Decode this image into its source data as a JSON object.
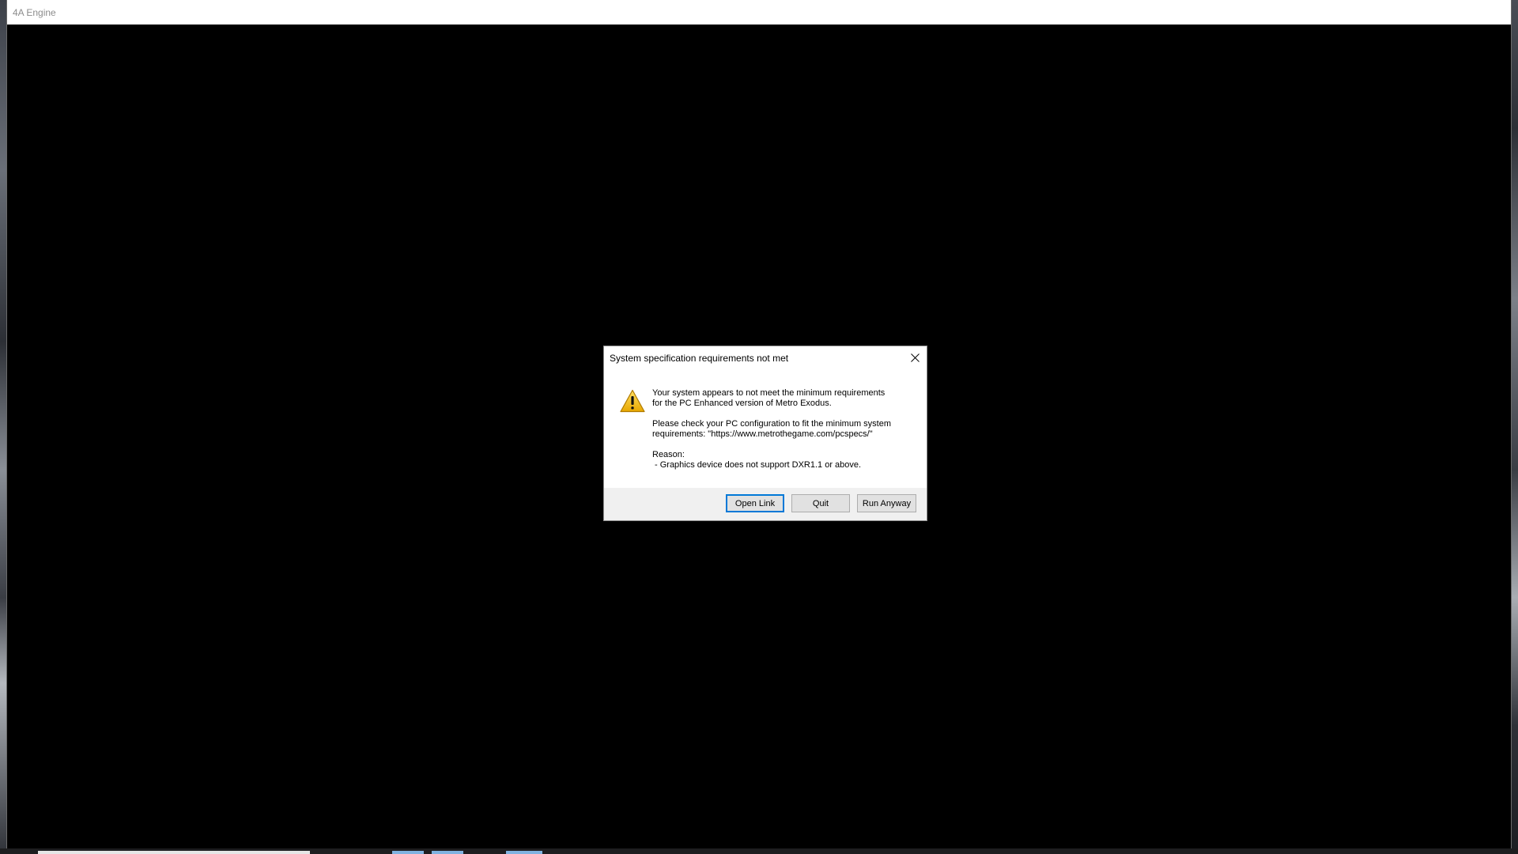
{
  "window": {
    "title": "4A Engine"
  },
  "dialog": {
    "title": "System specification requirements not met",
    "close_icon": "close-icon",
    "warning_icon": "warning-icon",
    "message": {
      "line1": "Your system appears to not meet the minimum requirements",
      "line2": "for the PC Enhanced version of Metro Exodus.",
      "line3": "Please check your PC configuration to fit the minimum system",
      "line4": "requirements: \"https://www.metrothegame.com/pcspecs/\"",
      "reason_label": "Reason:",
      "reason_detail": " - Graphics device does not support DXR1.1 or above."
    },
    "buttons": {
      "open_link": "Open Link",
      "quit": "Quit",
      "run_anyway": "Run Anyway"
    }
  },
  "colors": {
    "game_background": "#000000",
    "dialog_background": "#ffffff",
    "footer_background": "#f0f0f0",
    "focus_border": "#0078d7",
    "warning_yellow": "#f2c200"
  }
}
